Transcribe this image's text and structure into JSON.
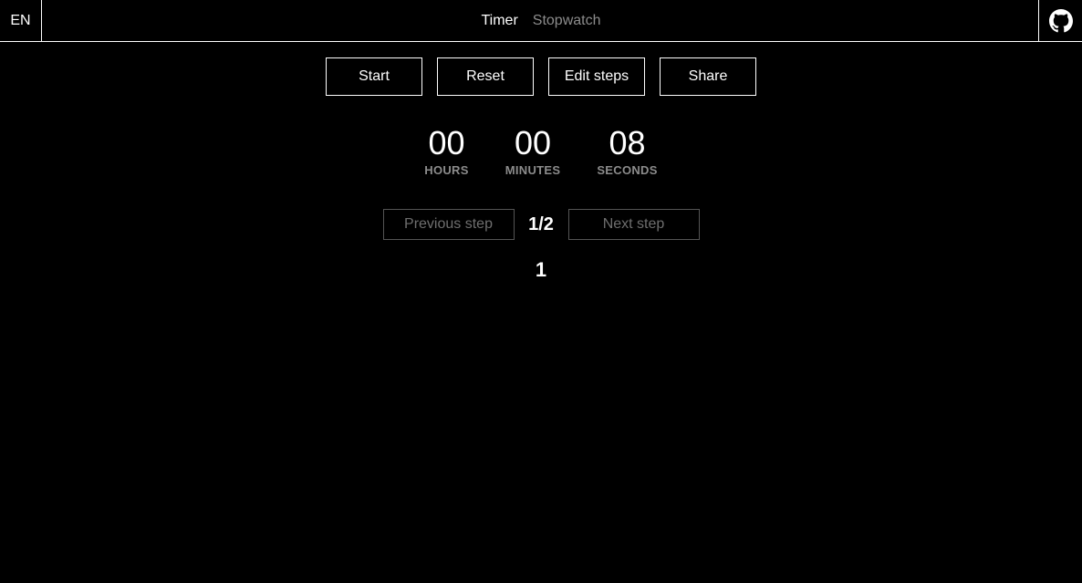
{
  "header": {
    "language": "EN",
    "tabs": [
      {
        "label": "Timer",
        "active": true
      },
      {
        "label": "Stopwatch",
        "active": false
      }
    ],
    "github_icon": "github-icon"
  },
  "actions": {
    "start": "Start",
    "reset": "Reset",
    "edit_steps": "Edit steps",
    "share": "Share"
  },
  "clock": {
    "hours": "00",
    "hours_label": "HOURS",
    "minutes": "00",
    "minutes_label": "MINUTES",
    "seconds": "08",
    "seconds_label": "SECONDS"
  },
  "steps": {
    "previous": "Previous step",
    "counter": "1/2",
    "next": "Next step",
    "current_name": "1"
  },
  "colors": {
    "background": "#000000",
    "foreground": "#ffffff",
    "muted": "#8c8c8c"
  }
}
